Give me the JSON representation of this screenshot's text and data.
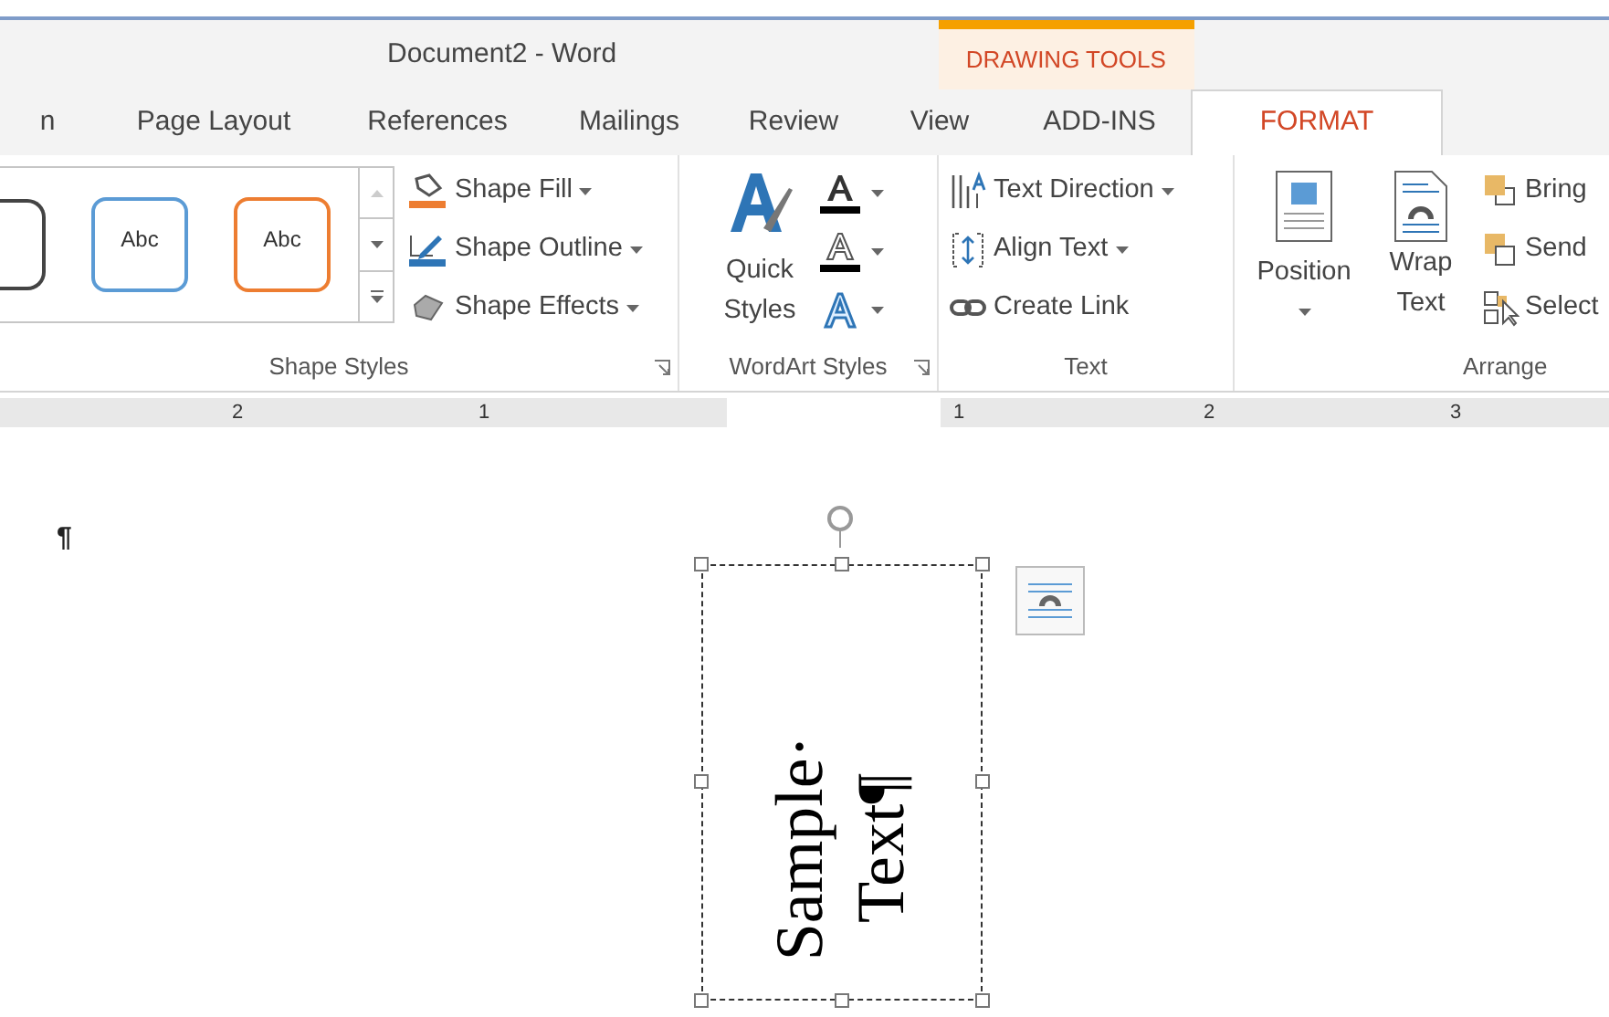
{
  "window": {
    "title": "Document2 - Word"
  },
  "contextual_group": {
    "label": "DRAWING TOOLS"
  },
  "tabs": [
    {
      "label": "n",
      "selected": false
    },
    {
      "label": "Page Layout",
      "selected": false
    },
    {
      "label": "References",
      "selected": false
    },
    {
      "label": "Mailings",
      "selected": false
    },
    {
      "label": "Review",
      "selected": false
    },
    {
      "label": "View",
      "selected": false
    },
    {
      "label": "ADD-INS",
      "selected": false
    },
    {
      "label": "FORMAT",
      "selected": true
    }
  ],
  "shape_styles": {
    "label": "Shape Styles",
    "gallery": [
      {
        "label": "Abc",
        "color": "#5b9bd5"
      },
      {
        "label": "Abc",
        "color": "#ed7d31"
      }
    ],
    "commands": [
      "Shape Fill",
      "Shape Outline",
      "Shape Effects"
    ]
  },
  "wordart_styles": {
    "label": "WordArt Styles",
    "quick_styles": "Quick Styles"
  },
  "text_group": {
    "label": "Text",
    "commands": [
      "Text Direction",
      "Align Text",
      "Create Link"
    ]
  },
  "arrange": {
    "label": "Arrange",
    "large": [
      "Position",
      "Wrap Text"
    ],
    "small": [
      "Bring",
      "Send",
      "Select"
    ]
  },
  "ruler": {
    "marks": [
      "2",
      "1",
      "1",
      "2",
      "3"
    ]
  },
  "document": {
    "paragraph_mark": "¶",
    "text_box": {
      "lines": [
        "Sample·",
        "Text¶"
      ]
    }
  }
}
